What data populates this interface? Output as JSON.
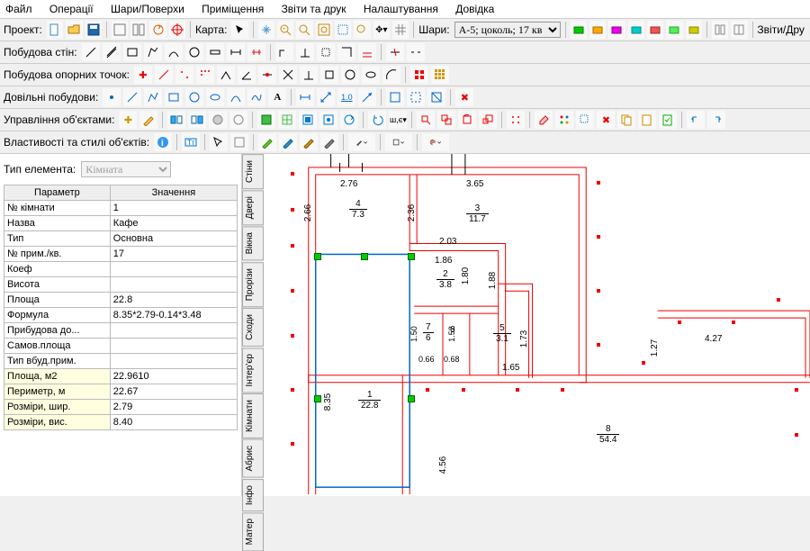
{
  "menu": {
    "file": "Файл",
    "ops": "Операції",
    "layers": "Шари/Поверхи",
    "rooms": "Приміщення",
    "reports": "Звіти та друк",
    "settings": "Налаштування",
    "help": "Довідка"
  },
  "tb1": {
    "project": "Проект:",
    "map": "Карта:",
    "layers": "Шари:",
    "layer_sel": "А-5; цоколь; 17 кв",
    "reports": "Звіти/Дру"
  },
  "tb2": {
    "walls": "Побудова стін:"
  },
  "tb3": {
    "points": "Побудова опорних точок:"
  },
  "tb4": {
    "free": "Довільні побудови:"
  },
  "tb5": {
    "obj": "Управління об'єктами:"
  },
  "tb6": {
    "props": "Властивості та стилі об'єктів:"
  },
  "left": {
    "elemtype_lbl": "Тип елемента:",
    "elemtype_val": "Кімната",
    "col_param": "Параметр",
    "col_val": "Значення",
    "rows": [
      {
        "p": "№ кімнати",
        "v": "1"
      },
      {
        "p": "Назва",
        "v": "Кафе"
      },
      {
        "p": "Тип",
        "v": "Основна"
      },
      {
        "p": "№ прим./кв.",
        "v": "17"
      },
      {
        "p": "Коеф",
        "v": ""
      },
      {
        "p": "Висота",
        "v": ""
      },
      {
        "p": "Площа",
        "v": "22.8"
      },
      {
        "p": "Формула",
        "v": "8.35*2.79-0.14*3.48"
      },
      {
        "p": "Прибудова до...",
        "v": ""
      },
      {
        "p": "Самов.площа",
        "v": ""
      },
      {
        "p": "Тип вбуд.прим.",
        "v": ""
      },
      {
        "p": "Площа, м2",
        "v": "22.9610",
        "hi": 1
      },
      {
        "p": "Периметр, м",
        "v": "22.67",
        "hi": 1
      },
      {
        "p": "Розміри, шир.",
        "v": "2.79",
        "hi": 1
      },
      {
        "p": "Розміри, вис.",
        "v": "8.40",
        "hi": 1
      }
    ]
  },
  "tabs": [
    "Стіни",
    "Двері",
    "Вікна",
    "Прорізи",
    "Сходи",
    "Інтер'єр",
    "Кімнати",
    "Абрис",
    "Інфо",
    "Матер"
  ],
  "plan": {
    "d_276": "2.76",
    "d_365": "3.65",
    "d_266": "2.66",
    "d_236": "2.36",
    "d_203": "2.03",
    "d_186": "1.86",
    "d_180": "1.80",
    "d_188": "1.88",
    "d_150": "1.50",
    "d_152": "1.52",
    "d_066": "0.66",
    "d_068": "0.68",
    "d_173": "1.73",
    "d_165": "1.65",
    "d_835": "8.35",
    "d_127": "1.27",
    "d_427": "4.27",
    "d_456": "4.56",
    "r4n": "4",
    "r4d": "7.3",
    "r3n": "3",
    "r3d": "11.7",
    "r2n": "2",
    "r2d": "3.8",
    "r7n": "7",
    "r7d": "6",
    "r6n": "6",
    "r5n": "5",
    "r5d": "3.1",
    "r1n": "1",
    "r1d": "22.8",
    "r8n": "8",
    "r8d": "54.4"
  }
}
